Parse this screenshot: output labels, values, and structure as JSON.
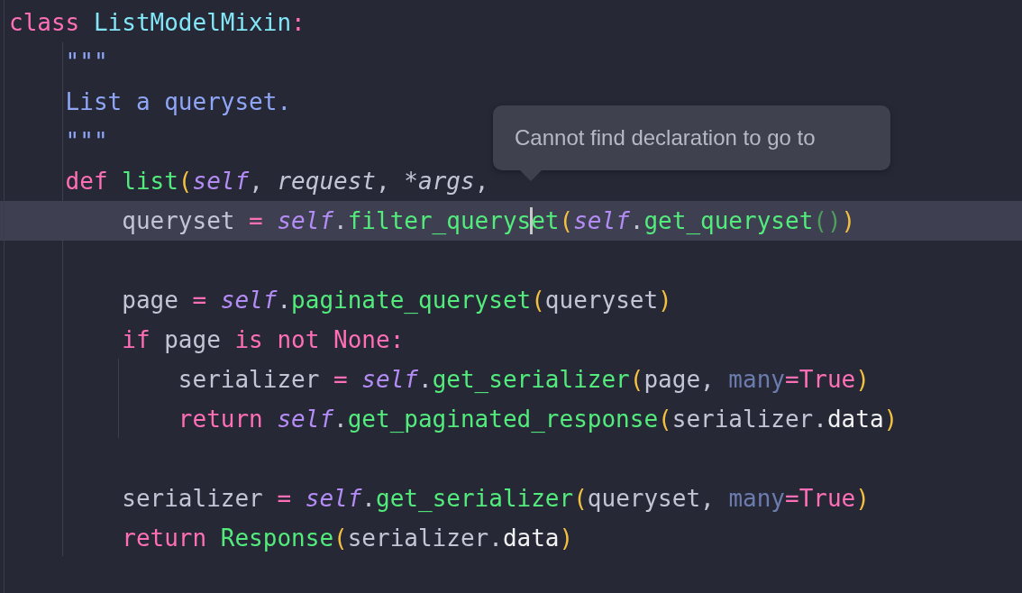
{
  "editor": {
    "lines": [
      {
        "current": false,
        "tokens": [
          {
            "kind": "kw",
            "text": "class "
          },
          {
            "kind": "cls",
            "text": "ListModelMixin"
          },
          {
            "kind": "kw",
            "text": ":"
          }
        ]
      },
      {
        "current": false,
        "tokens": [
          {
            "kind": "doc",
            "text": "    \"\"\""
          }
        ]
      },
      {
        "current": false,
        "tokens": [
          {
            "kind": "doc",
            "text": "    List a queryset."
          }
        ]
      },
      {
        "current": false,
        "tokens": [
          {
            "kind": "doc",
            "text": "    \"\"\""
          }
        ]
      },
      {
        "current": false,
        "tokens": [
          {
            "kind": "kw",
            "text": "    def "
          },
          {
            "kind": "fn",
            "text": "list"
          },
          {
            "kind": "paren",
            "text": "("
          },
          {
            "kind": "self",
            "text": "self"
          },
          {
            "kind": "plain",
            "text": ", "
          },
          {
            "kind": "param",
            "text": "request"
          },
          {
            "kind": "plain",
            "text": ", "
          },
          {
            "kind": "param",
            "text": "*args"
          },
          {
            "kind": "plain",
            "text": ","
          }
        ]
      },
      {
        "current": true,
        "tokens": [
          {
            "kind": "plain",
            "text": "        queryset "
          },
          {
            "kind": "op",
            "text": "= "
          },
          {
            "kind": "self",
            "text": "self"
          },
          {
            "kind": "plain",
            "text": "."
          },
          {
            "kind": "fn",
            "text": "filter_querys"
          },
          {
            "kind": "cursor"
          },
          {
            "kind": "fn",
            "text": "et"
          },
          {
            "kind": "paren",
            "text": "("
          },
          {
            "kind": "self",
            "text": "self"
          },
          {
            "kind": "plain",
            "text": "."
          },
          {
            "kind": "fn",
            "text": "get_queryset"
          },
          {
            "kind": "paren2",
            "text": "()"
          },
          {
            "kind": "paren",
            "text": ")"
          }
        ]
      },
      {
        "current": false
      },
      {
        "current": false,
        "tokens": [
          {
            "kind": "plain",
            "text": "        page "
          },
          {
            "kind": "op",
            "text": "= "
          },
          {
            "kind": "self",
            "text": "self"
          },
          {
            "kind": "plain",
            "text": "."
          },
          {
            "kind": "fn",
            "text": "paginate_queryset"
          },
          {
            "kind": "paren",
            "text": "("
          },
          {
            "kind": "plain",
            "text": "queryset"
          },
          {
            "kind": "paren",
            "text": ")"
          }
        ]
      },
      {
        "current": false,
        "tokens": [
          {
            "kind": "kw",
            "text": "        if"
          },
          {
            "kind": "plain",
            "text": " page "
          },
          {
            "kind": "kw",
            "text": "is not None:"
          }
        ]
      },
      {
        "current": false,
        "tokens": [
          {
            "kind": "plain",
            "text": "            serializer "
          },
          {
            "kind": "op",
            "text": "= "
          },
          {
            "kind": "self",
            "text": "self"
          },
          {
            "kind": "plain",
            "text": "."
          },
          {
            "kind": "fn",
            "text": "get_serializer"
          },
          {
            "kind": "paren",
            "text": "("
          },
          {
            "kind": "plain",
            "text": "page, "
          },
          {
            "kind": "named",
            "text": "many"
          },
          {
            "kind": "op",
            "text": "=True"
          },
          {
            "kind": "paren",
            "text": ")"
          }
        ]
      },
      {
        "current": false,
        "tokens": [
          {
            "kind": "kw",
            "text": "            return "
          },
          {
            "kind": "self",
            "text": "self"
          },
          {
            "kind": "plain",
            "text": "."
          },
          {
            "kind": "fn",
            "text": "get_paginated_response"
          },
          {
            "kind": "paren",
            "text": "("
          },
          {
            "kind": "plain",
            "text": "serializer."
          },
          {
            "kind": "attr",
            "text": "data"
          },
          {
            "kind": "paren",
            "text": ")"
          }
        ]
      },
      {
        "current": false
      },
      {
        "current": false,
        "tokens": [
          {
            "kind": "plain",
            "text": "        serializer "
          },
          {
            "kind": "op",
            "text": "= "
          },
          {
            "kind": "self",
            "text": "self"
          },
          {
            "kind": "plain",
            "text": "."
          },
          {
            "kind": "fn",
            "text": "get_serializer"
          },
          {
            "kind": "paren",
            "text": "("
          },
          {
            "kind": "plain",
            "text": "queryset, "
          },
          {
            "kind": "named",
            "text": "many"
          },
          {
            "kind": "op",
            "text": "=True"
          },
          {
            "kind": "paren",
            "text": ")"
          }
        ]
      },
      {
        "current": false,
        "tokens": [
          {
            "kind": "kw",
            "text": "        return "
          },
          {
            "kind": "fn",
            "text": "Response"
          },
          {
            "kind": "paren",
            "text": "("
          },
          {
            "kind": "plain",
            "text": "serializer."
          },
          {
            "kind": "attr",
            "text": "data"
          },
          {
            "kind": "paren",
            "text": ")"
          }
        ]
      }
    ],
    "tooltip": {
      "text": "Cannot find declaration to go to"
    }
  }
}
